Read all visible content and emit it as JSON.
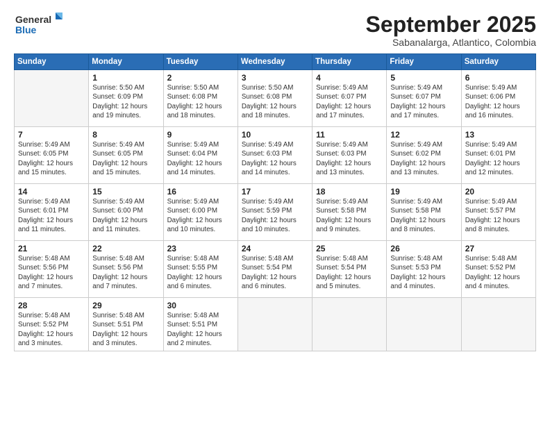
{
  "logo": {
    "line1": "General",
    "line2": "Blue"
  },
  "title": "September 2025",
  "subtitle": "Sabanalarga, Atlantico, Colombia",
  "days_of_week": [
    "Sunday",
    "Monday",
    "Tuesday",
    "Wednesday",
    "Thursday",
    "Friday",
    "Saturday"
  ],
  "weeks": [
    [
      {
        "day": "",
        "info": ""
      },
      {
        "day": "1",
        "info": "Sunrise: 5:50 AM\nSunset: 6:09 PM\nDaylight: 12 hours\nand 19 minutes."
      },
      {
        "day": "2",
        "info": "Sunrise: 5:50 AM\nSunset: 6:08 PM\nDaylight: 12 hours\nand 18 minutes."
      },
      {
        "day": "3",
        "info": "Sunrise: 5:50 AM\nSunset: 6:08 PM\nDaylight: 12 hours\nand 18 minutes."
      },
      {
        "day": "4",
        "info": "Sunrise: 5:49 AM\nSunset: 6:07 PM\nDaylight: 12 hours\nand 17 minutes."
      },
      {
        "day": "5",
        "info": "Sunrise: 5:49 AM\nSunset: 6:07 PM\nDaylight: 12 hours\nand 17 minutes."
      },
      {
        "day": "6",
        "info": "Sunrise: 5:49 AM\nSunset: 6:06 PM\nDaylight: 12 hours\nand 16 minutes."
      }
    ],
    [
      {
        "day": "7",
        "info": "Sunrise: 5:49 AM\nSunset: 6:05 PM\nDaylight: 12 hours\nand 15 minutes."
      },
      {
        "day": "8",
        "info": "Sunrise: 5:49 AM\nSunset: 6:05 PM\nDaylight: 12 hours\nand 15 minutes."
      },
      {
        "day": "9",
        "info": "Sunrise: 5:49 AM\nSunset: 6:04 PM\nDaylight: 12 hours\nand 14 minutes."
      },
      {
        "day": "10",
        "info": "Sunrise: 5:49 AM\nSunset: 6:03 PM\nDaylight: 12 hours\nand 14 minutes."
      },
      {
        "day": "11",
        "info": "Sunrise: 5:49 AM\nSunset: 6:03 PM\nDaylight: 12 hours\nand 13 minutes."
      },
      {
        "day": "12",
        "info": "Sunrise: 5:49 AM\nSunset: 6:02 PM\nDaylight: 12 hours\nand 13 minutes."
      },
      {
        "day": "13",
        "info": "Sunrise: 5:49 AM\nSunset: 6:01 PM\nDaylight: 12 hours\nand 12 minutes."
      }
    ],
    [
      {
        "day": "14",
        "info": "Sunrise: 5:49 AM\nSunset: 6:01 PM\nDaylight: 12 hours\nand 11 minutes."
      },
      {
        "day": "15",
        "info": "Sunrise: 5:49 AM\nSunset: 6:00 PM\nDaylight: 12 hours\nand 11 minutes."
      },
      {
        "day": "16",
        "info": "Sunrise: 5:49 AM\nSunset: 6:00 PM\nDaylight: 12 hours\nand 10 minutes."
      },
      {
        "day": "17",
        "info": "Sunrise: 5:49 AM\nSunset: 5:59 PM\nDaylight: 12 hours\nand 10 minutes."
      },
      {
        "day": "18",
        "info": "Sunrise: 5:49 AM\nSunset: 5:58 PM\nDaylight: 12 hours\nand 9 minutes."
      },
      {
        "day": "19",
        "info": "Sunrise: 5:49 AM\nSunset: 5:58 PM\nDaylight: 12 hours\nand 8 minutes."
      },
      {
        "day": "20",
        "info": "Sunrise: 5:49 AM\nSunset: 5:57 PM\nDaylight: 12 hours\nand 8 minutes."
      }
    ],
    [
      {
        "day": "21",
        "info": "Sunrise: 5:48 AM\nSunset: 5:56 PM\nDaylight: 12 hours\nand 7 minutes."
      },
      {
        "day": "22",
        "info": "Sunrise: 5:48 AM\nSunset: 5:56 PM\nDaylight: 12 hours\nand 7 minutes."
      },
      {
        "day": "23",
        "info": "Sunrise: 5:48 AM\nSunset: 5:55 PM\nDaylight: 12 hours\nand 6 minutes."
      },
      {
        "day": "24",
        "info": "Sunrise: 5:48 AM\nSunset: 5:54 PM\nDaylight: 12 hours\nand 6 minutes."
      },
      {
        "day": "25",
        "info": "Sunrise: 5:48 AM\nSunset: 5:54 PM\nDaylight: 12 hours\nand 5 minutes."
      },
      {
        "day": "26",
        "info": "Sunrise: 5:48 AM\nSunset: 5:53 PM\nDaylight: 12 hours\nand 4 minutes."
      },
      {
        "day": "27",
        "info": "Sunrise: 5:48 AM\nSunset: 5:52 PM\nDaylight: 12 hours\nand 4 minutes."
      }
    ],
    [
      {
        "day": "28",
        "info": "Sunrise: 5:48 AM\nSunset: 5:52 PM\nDaylight: 12 hours\nand 3 minutes."
      },
      {
        "day": "29",
        "info": "Sunrise: 5:48 AM\nSunset: 5:51 PM\nDaylight: 12 hours\nand 3 minutes."
      },
      {
        "day": "30",
        "info": "Sunrise: 5:48 AM\nSunset: 5:51 PM\nDaylight: 12 hours\nand 2 minutes."
      },
      {
        "day": "",
        "info": ""
      },
      {
        "day": "",
        "info": ""
      },
      {
        "day": "",
        "info": ""
      },
      {
        "day": "",
        "info": ""
      }
    ]
  ]
}
